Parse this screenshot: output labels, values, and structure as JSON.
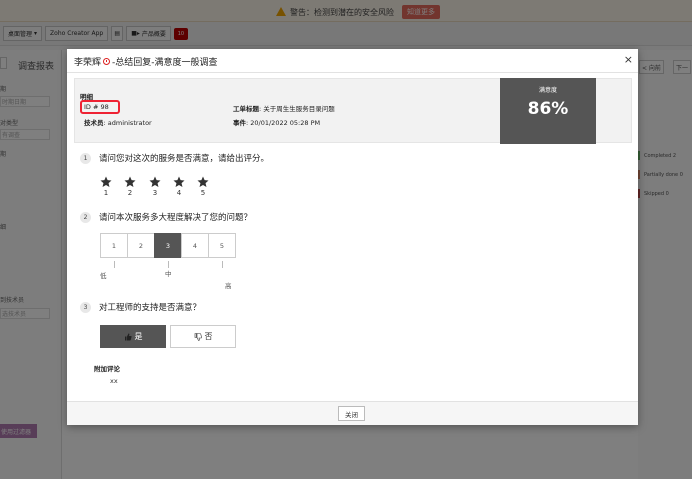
{
  "background": {
    "warning_text": "警告：检测到潜在的安全风险",
    "warning_button": "知道更多",
    "toolbar": {
      "desktop_manage": "桌面管理",
      "zoho_app": "Zoho Creator App",
      "product_news": "产品概要",
      "badge": "10"
    },
    "left_panel": {
      "title": "调查报表",
      "items": [
        "期",
        "时期日期",
        "对类型",
        "有调查",
        "期",
        "细",
        "到技术员",
        "选技术员"
      ],
      "filter_button": "使用过滤器"
    },
    "right_panel": {
      "prev": "< 向前",
      "next": "下一",
      "statuses": [
        {
          "label": "Completed 2",
          "color": "#6cbf6c"
        },
        {
          "label": "Partially done 0",
          "color": "#e08a6b"
        },
        {
          "label": "Skipped 0",
          "color": "#c44a4a"
        }
      ]
    }
  },
  "modal": {
    "title_requester": "李荣辉",
    "title_rest": "-总结回复-满意度一般调查",
    "close_glyph": "×",
    "info": {
      "section_title": "明细",
      "id_label": "ID #",
      "id_value": "98",
      "tech_label": "技术员",
      "tech_value": ": administrator",
      "subject_label": "工单标题",
      "subject_value": ": 关于周生生服务目录问题",
      "event_label": "事件",
      "event_value": ": 20/01/2022 05:28 PM"
    },
    "score": {
      "label": "满意度",
      "value": "86%"
    },
    "questions": [
      {
        "num": "1",
        "text": "请问您对这次的服务是否满意，请给出评分。",
        "stars": [
          "1",
          "2",
          "3",
          "4",
          "5"
        ]
      },
      {
        "num": "2",
        "text": "请问本次服务多大程度解决了您的问题？",
        "options": [
          "1",
          "2",
          "3",
          "4",
          "5"
        ],
        "selected": "3",
        "low_label": "低",
        "mid_label": "中",
        "high_label": "高"
      },
      {
        "num": "3",
        "text": "对工程师的支持是否满意？",
        "yes_label": "是",
        "no_label": "否",
        "selected": "yes"
      }
    ],
    "comment": {
      "title": "附加评论",
      "value": "xx"
    },
    "footer": {
      "close_label": "关闭"
    }
  }
}
